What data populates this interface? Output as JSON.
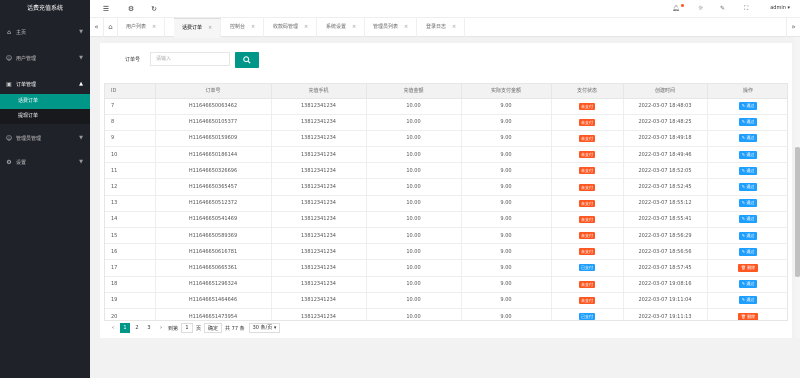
{
  "app": {
    "title": "话费充值系统"
  },
  "sidebar": {
    "items": [
      {
        "label": "主页",
        "icon": "home-icon",
        "glyph": "⌂",
        "has_caret": true
      },
      {
        "label": "用户管理",
        "icon": "user-icon",
        "glyph": "☺",
        "has_caret": true
      },
      {
        "label": "订单管理",
        "icon": "order-icon",
        "glyph": "▣",
        "open": true
      },
      {
        "label": "管理员管理",
        "icon": "admin-icon",
        "glyph": "☺",
        "has_caret": true
      },
      {
        "label": "设置",
        "icon": "gear-icon",
        "glyph": "⚙",
        "has_caret": true
      }
    ],
    "submenu": [
      {
        "label": "话费订单",
        "active": true
      },
      {
        "label": "提现订单",
        "active": false
      }
    ]
  },
  "header": {
    "user": "admin"
  },
  "tabs": [
    {
      "label": "用户列表"
    },
    {
      "label": "话费订单",
      "active": true
    },
    {
      "label": "控制台"
    },
    {
      "label": "收款码管理"
    },
    {
      "label": "系统设置"
    },
    {
      "label": "管理员列表"
    },
    {
      "label": "登录日志"
    }
  ],
  "search": {
    "label": "订单号",
    "placeholder": "请输入"
  },
  "table": {
    "columns": [
      "ID",
      "订单号",
      "充值手机",
      "充值金额",
      "实际支付金额",
      "支付状态",
      "创建时间",
      "操作"
    ],
    "rows": [
      {
        "id": "7",
        "order": "H11646650063462",
        "phone": "13812341234",
        "amount": "10.00",
        "paid": "9.00",
        "status": "未支付",
        "status_type": "unpaid",
        "time": "2022-03-07 18:48:03",
        "op": "通过",
        "op_type": "pass"
      },
      {
        "id": "8",
        "order": "H11646650105377",
        "phone": "13812341234",
        "amount": "10.00",
        "paid": "9.00",
        "status": "未支付",
        "status_type": "unpaid",
        "time": "2022-03-07 18:48:25",
        "op": "通过",
        "op_type": "pass"
      },
      {
        "id": "9",
        "order": "H11646650159609",
        "phone": "13812341234",
        "amount": "10.00",
        "paid": "9.00",
        "status": "未支付",
        "status_type": "unpaid",
        "time": "2022-03-07 18:49:18",
        "op": "通过",
        "op_type": "pass"
      },
      {
        "id": "10",
        "order": "H11646650186144",
        "phone": "13812341234",
        "amount": "10.00",
        "paid": "9.00",
        "status": "未支付",
        "status_type": "unpaid",
        "time": "2022-03-07 18:49:46",
        "op": "通过",
        "op_type": "pass"
      },
      {
        "id": "11",
        "order": "H11646650326696",
        "phone": "13812341234",
        "amount": "10.00",
        "paid": "9.00",
        "status": "未支付",
        "status_type": "unpaid",
        "time": "2022-03-07 18:52:05",
        "op": "通过",
        "op_type": "pass"
      },
      {
        "id": "12",
        "order": "H11646650365457",
        "phone": "13812341234",
        "amount": "10.00",
        "paid": "9.00",
        "status": "未支付",
        "status_type": "unpaid",
        "time": "2022-03-07 18:52:45",
        "op": "通过",
        "op_type": "pass"
      },
      {
        "id": "13",
        "order": "H11646650512372",
        "phone": "13812341234",
        "amount": "10.00",
        "paid": "9.00",
        "status": "未支付",
        "status_type": "unpaid",
        "time": "2022-03-07 18:55:12",
        "op": "通过",
        "op_type": "pass"
      },
      {
        "id": "14",
        "order": "H11646650541469",
        "phone": "13812341234",
        "amount": "10.00",
        "paid": "9.00",
        "status": "未支付",
        "status_type": "unpaid",
        "time": "2022-03-07 18:55:41",
        "op": "通过",
        "op_type": "pass"
      },
      {
        "id": "15",
        "order": "H11646650589369",
        "phone": "13812341234",
        "amount": "10.00",
        "paid": "9.00",
        "status": "未支付",
        "status_type": "unpaid",
        "time": "2022-03-07 18:56:29",
        "op": "通过",
        "op_type": "pass"
      },
      {
        "id": "16",
        "order": "H11646650616781",
        "phone": "13812341234",
        "amount": "10.00",
        "paid": "9.00",
        "status": "未支付",
        "status_type": "unpaid",
        "time": "2022-03-07 18:56:56",
        "op": "通过",
        "op_type": "pass"
      },
      {
        "id": "17",
        "order": "H11646650665361",
        "phone": "13812341234",
        "amount": "10.00",
        "paid": "9.00",
        "status": "已支付",
        "status_type": "paid",
        "time": "2022-03-07 18:57:45",
        "op": "删除",
        "op_type": "delete"
      },
      {
        "id": "18",
        "order": "H11646651296324",
        "phone": "13812341234",
        "amount": "10.00",
        "paid": "9.00",
        "status": "未支付",
        "status_type": "unpaid",
        "time": "2022-03-07 19:08:16",
        "op": "通过",
        "op_type": "pass"
      },
      {
        "id": "19",
        "order": "H11646651464646",
        "phone": "13812341234",
        "amount": "10.00",
        "paid": "9.00",
        "status": "未支付",
        "status_type": "unpaid",
        "time": "2022-03-07 19:11:04",
        "op": "通过",
        "op_type": "pass"
      },
      {
        "id": "20",
        "order": "H11646651473954",
        "phone": "13812341234",
        "amount": "10.00",
        "paid": "9.00",
        "status": "已支付",
        "status_type": "paid",
        "time": "2022-03-07 19:11:13",
        "op": "删除",
        "op_type": "delete"
      }
    ]
  },
  "pager": {
    "pages": [
      "1",
      "2",
      "3"
    ],
    "current": "1",
    "goto_label": "到第",
    "goto_value": "1",
    "page_unit": "页",
    "confirm": "确定",
    "total": "共 77 条",
    "per_page": "30 条/页"
  },
  "colors": {
    "accent": "#009688",
    "unpaid": "#ff5722",
    "paid": "#1e9fff"
  }
}
